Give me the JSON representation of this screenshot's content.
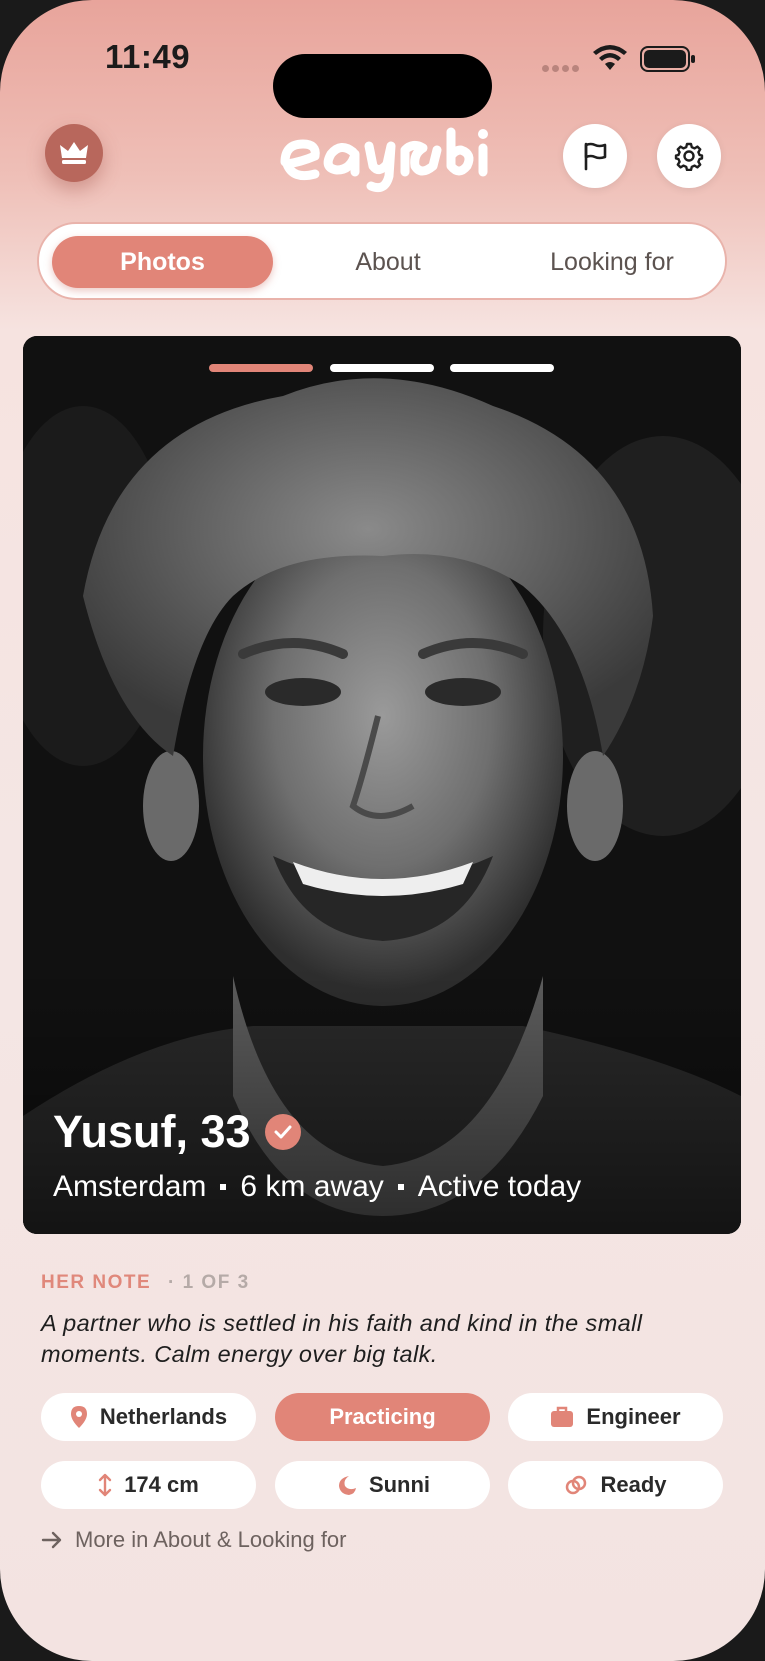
{
  "status_bar": {
    "time": "11:49"
  },
  "header": {
    "logo_text": "eayrbi",
    "crown_icon": "crown-icon",
    "flag_icon": "flag-icon",
    "settings_icon": "gear-icon"
  },
  "tabs": [
    {
      "label": "Photos",
      "active": true
    },
    {
      "label": "About",
      "active": false
    },
    {
      "label": "Looking for",
      "active": false
    }
  ],
  "photo_carousel": {
    "current": 1,
    "total": 3
  },
  "profile": {
    "name_age": "Yusuf, 33",
    "verified": true,
    "city": "Amsterdam",
    "distance": "6 km away",
    "activity": "Active today"
  },
  "note": {
    "label": "HER NOTE",
    "count": "· 1 OF 3",
    "text": "A partner who is settled in his faith and kind in the small moments. Calm energy over big talk."
  },
  "chips": [
    {
      "label": "Netherlands",
      "icon": "location-pin-icon",
      "accent": false
    },
    {
      "label": "Practicing",
      "icon": "",
      "accent": true
    },
    {
      "label": "Engineer",
      "icon": "briefcase-icon",
      "accent": false
    },
    {
      "label": "174 cm",
      "icon": "height-arrows-icon",
      "accent": false
    },
    {
      "label": "Sunni",
      "icon": "moon-icon",
      "accent": false
    },
    {
      "label": "Ready",
      "icon": "rings-icon",
      "accent": false
    }
  ],
  "more_link": "More in About & Looking for",
  "colors": {
    "accent": "#e18578",
    "crown_bg": "#b8675c"
  }
}
